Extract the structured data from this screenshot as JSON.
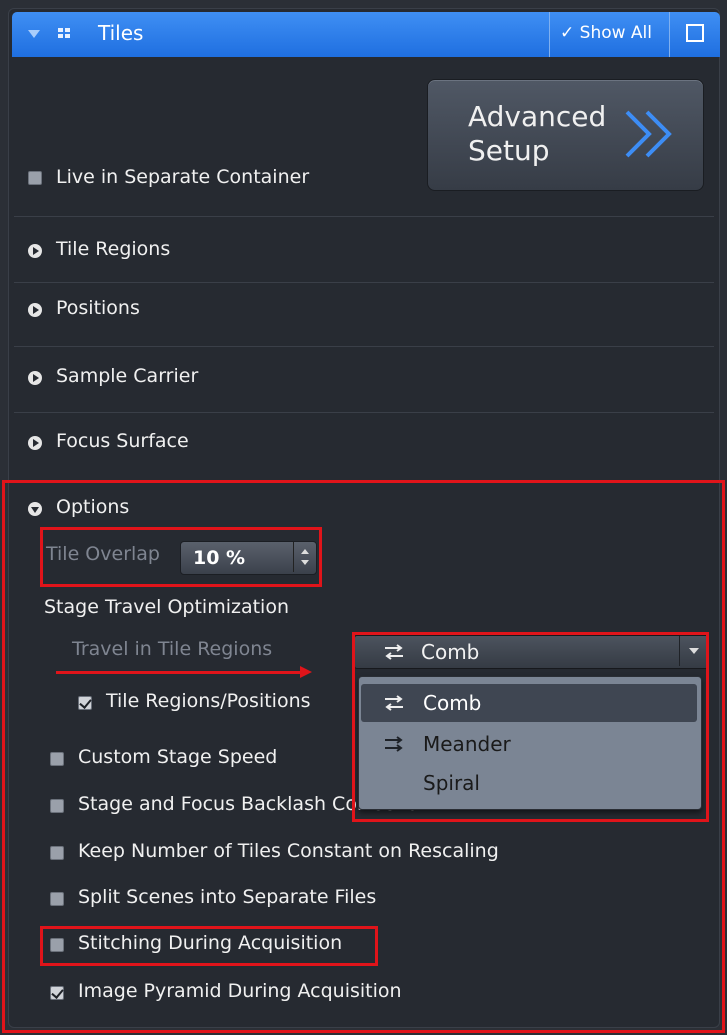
{
  "header": {
    "title": "Tiles",
    "show_all": "✓ Show All"
  },
  "advanced_setup": {
    "line1": "Advanced",
    "line2": "Setup"
  },
  "live_in_separate_container": {
    "label": "Live in Separate Container",
    "checked": false
  },
  "sections": {
    "tile_regions": "Tile Regions",
    "positions": "Positions",
    "sample_carrier": "Sample Carrier",
    "focus_surface": "Focus Surface",
    "options": "Options"
  },
  "options": {
    "tile_overlap_label": "Tile Overlap",
    "tile_overlap_value": "10 %",
    "stage_travel_heading": "Stage Travel Optimization",
    "travel_in_tile_regions_label": "Travel in Tile Regions",
    "travel_mode_selected": "Comb",
    "travel_mode_options": [
      "Comb",
      "Meander",
      "Spiral"
    ],
    "tile_regions_positions": {
      "label": "Tile Regions/Positions",
      "checked": true
    },
    "custom_stage_speed": {
      "label": "Custom Stage Speed",
      "checked": false
    },
    "backlash_correction": {
      "label": "Stage and Focus Backlash Correction",
      "checked": false
    },
    "keep_number_tiles": {
      "label": "Keep Number of Tiles Constant on Rescaling",
      "checked": false
    },
    "split_scenes": {
      "label": "Split Scenes into Separate Files",
      "checked": false
    },
    "stitching": {
      "label": "Stitching During Acquisition",
      "checked": false
    },
    "image_pyramid": {
      "label": "Image Pyramid During Acquisition",
      "checked": true
    }
  },
  "colors": {
    "header_blue": "#2a7ae8",
    "annotation_red": "#e0141a",
    "panel_bg": "#262a31"
  }
}
